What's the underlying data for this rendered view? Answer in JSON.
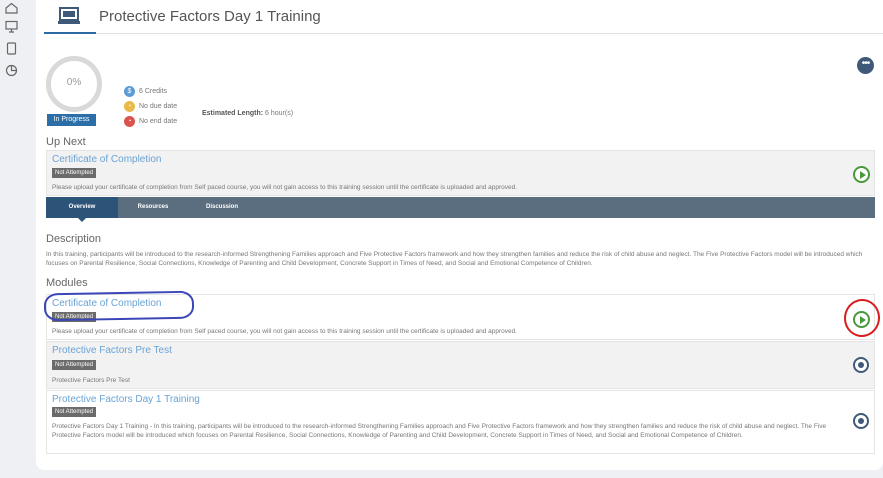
{
  "sidebar": {
    "icons": [
      "home-icon",
      "monitor-icon",
      "tablet-icon",
      "pie-chart-icon"
    ]
  },
  "header": {
    "title": "Protective Factors Day 1 Training",
    "icon": "laptop-icon"
  },
  "summary": {
    "progress_text": "0%",
    "progress_value": 0,
    "status": "In Progress",
    "credits": "6 Credits",
    "due_date": "No due date",
    "end_date": "No end date",
    "estimated_label": "Estimated Length:",
    "estimated_value": "6 hour(s)",
    "more_glyph": "•••"
  },
  "up_next": {
    "heading": "Up Next",
    "title": "Certificate of Completion",
    "badge": "Not Attempted",
    "description": "Please upload your certificate of completion from Self paced course, you will not gain access to this training session until the certificate is uploaded and approved."
  },
  "tabs": [
    {
      "label": "Overview",
      "active": true
    },
    {
      "label": "Resources",
      "active": false
    },
    {
      "label": "Discussion",
      "active": false
    }
  ],
  "description": {
    "heading": "Description",
    "text": "In this training, participants will be introduced to the research-informed Strengthening Families approach and Five Protective Factors framework and how they strengthen families and reduce the risk of child abuse and neglect. The Five Protective Factors model will be introduced which focuses on Parental Resilience, Social Connections, Knowledge of Parenting and Child Development, Concrete Support in Times of Need, and Social and Emotional Competence of Children."
  },
  "modules": {
    "heading": "Modules",
    "items": [
      {
        "title": "Certificate of Completion",
        "badge": "Not Attempted",
        "description": "Please upload your certificate of completion from Self paced course, you will not gain access to this training session until the certificate is uploaded and approved.",
        "action_icon": "play-icon"
      },
      {
        "title": "Protective Factors Pre Test",
        "badge": "Not Attempted",
        "description": "Protective Factors Pre Test",
        "action_icon": "lock-icon"
      },
      {
        "title": "Protective Factors Day 1 Training",
        "badge": "Not Attempted",
        "description": "Protective Factors Day 1 Training - In this training, participants will be introduced to the research-informed Strengthening Families approach and Five Protective Factors framework and how they strengthen families and reduce the risk of child abuse and neglect. The Five Protective Factors model will be introduced which focuses on Parental Resilience, Social Connections, Knowledge of Parenting and Child Development, Concrete Support in Times of Need, and Social and Emotional Competence of Children.",
        "action_icon": "lock-icon"
      }
    ]
  },
  "colors": {
    "accent": "#2c6fa8",
    "link": "#6aa3d6",
    "play": "#4a9a3c",
    "badge": "#6b6b6b",
    "tabbar": "#5a6e7f",
    "annotation_blue": "#3b47b8",
    "annotation_red": "#d91c1c"
  }
}
